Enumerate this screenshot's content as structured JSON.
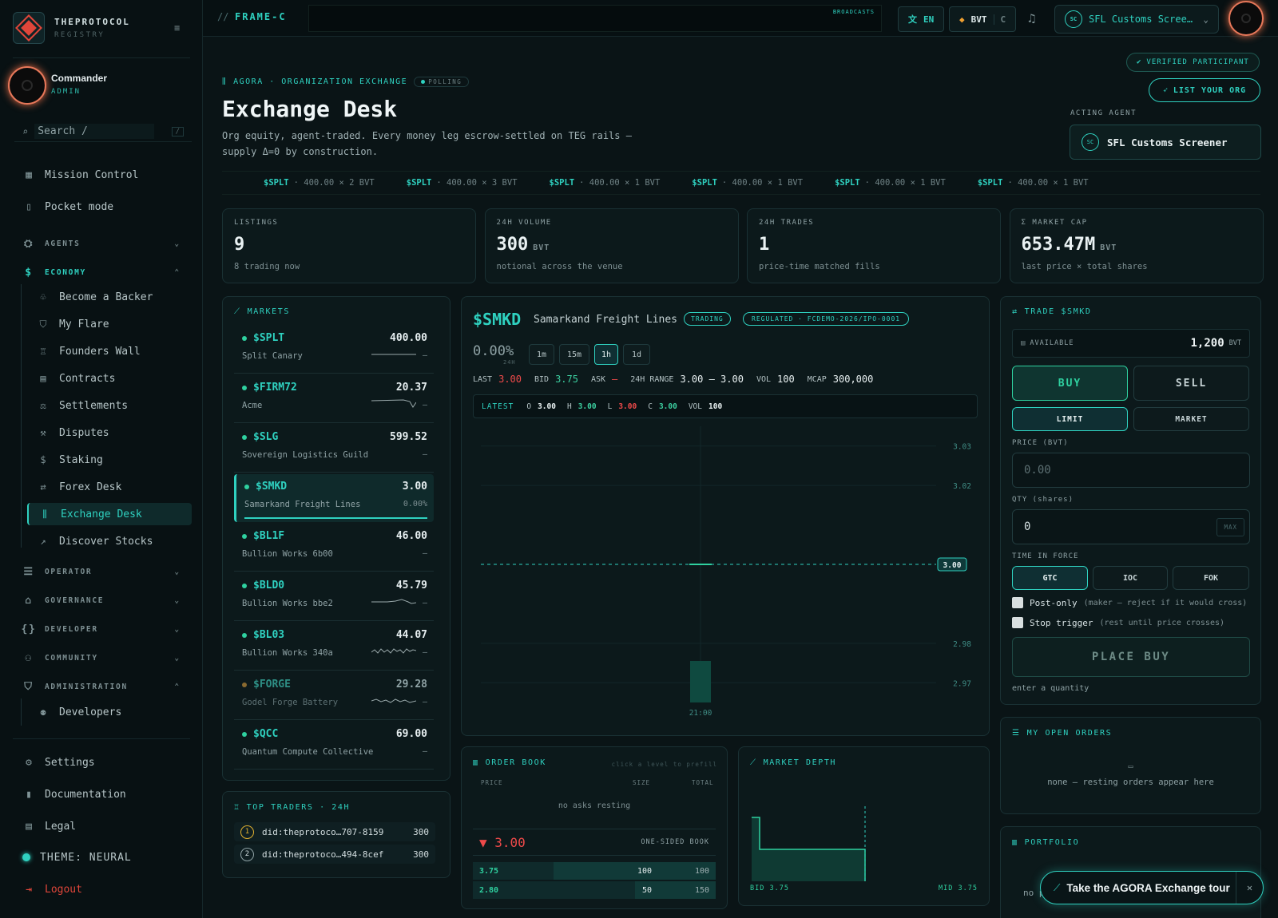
{
  "brand": {
    "name": "THEPROTOCOL",
    "sub": "REGISTRY"
  },
  "user": {
    "name": "Commander",
    "role": "ADMIN"
  },
  "search": {
    "placeholder": "Search  /",
    "shortcut": "/"
  },
  "nav": {
    "top": [
      "Mission Control",
      "Pocket mode"
    ],
    "sections": {
      "agents": "AGENTS",
      "economy": "ECONOMY",
      "operator": "OPERATOR",
      "governance": "GOVERNANCE",
      "developer": "DEVELOPER",
      "community": "COMMUNITY",
      "administration": "ADMINISTRATION"
    },
    "economy_items": [
      "Become a Backer",
      "My Flare",
      "Founders Wall",
      "Contracts",
      "Settlements",
      "Disputes",
      "Staking",
      "Forex Desk",
      "Exchange Desk",
      "Discover Stocks"
    ],
    "admin_items": [
      "Developers"
    ],
    "bottom": [
      "Settings",
      "Documentation",
      "Legal",
      "THEME: NEURAL",
      "Logout"
    ]
  },
  "topbar": {
    "frame": "FRAME-C",
    "frame_prefix": "//",
    "broadcasts": "BROADCASTS",
    "lang": "EN",
    "currency": "BVT",
    "currency_sub": "C",
    "agent": "SFL Customs Scree…",
    "agent_badge": "SC"
  },
  "header": {
    "verified": "VERIFIED PARTICIPANT",
    "list_org": "LIST YOUR ORG",
    "breadcrumb": "AGORA · ORGANIZATION EXCHANGE",
    "polling": "POLLING",
    "title": "Exchange Desk",
    "desc1": "Org equity, agent-traded. Every money leg escrow-settled on TEG rails —",
    "desc2": "supply Δ=0 by construction.",
    "acting_label": "ACTING AGENT",
    "acting_agent": "SFL Customs Screener",
    "acting_badge": "SC"
  },
  "ticker": [
    {
      "sym": "$SPLT",
      "text": "· 400.00 × 2 BVT"
    },
    {
      "sym": "$SPLT",
      "text": "· 400.00 × 3 BVT"
    },
    {
      "sym": "$SPLT",
      "text": "· 400.00 × 1 BVT"
    },
    {
      "sym": "$SPLT",
      "text": "· 400.00 × 1 BVT"
    },
    {
      "sym": "$SPLT",
      "text": "· 400.00 × 1 BVT"
    },
    {
      "sym": "$SPLT",
      "text": "· 400.00 × 1 BVT"
    }
  ],
  "stats": [
    {
      "label": "LISTINGS",
      "value": "9",
      "unit": "",
      "sub": "8 trading now"
    },
    {
      "label": "24H VOLUME",
      "value": "300",
      "unit": "BVT",
      "sub": "notional across the venue"
    },
    {
      "label": "24H TRADES",
      "value": "1",
      "unit": "",
      "sub": "price-time matched fills"
    },
    {
      "label": "Σ MARKET CAP",
      "value": "653.47M",
      "unit": "BVT",
      "sub": "last price × total shares"
    }
  ],
  "markets": {
    "title": "MARKETS",
    "rows": [
      {
        "sym": "$SPLT",
        "price": "400.00",
        "name": "Split Canary",
        "chg": "—"
      },
      {
        "sym": "$FIRM72",
        "price": "20.37",
        "name": "Acme",
        "chg": "—"
      },
      {
        "sym": "$SLG",
        "price": "599.52",
        "name": "Sovereign Logistics Guild",
        "chg": "—"
      },
      {
        "sym": "$SMKD",
        "price": "3.00",
        "name": "Samarkand Freight Lines",
        "chg": "0.00%"
      },
      {
        "sym": "$BL1F",
        "price": "46.00",
        "name": "Bullion Works 6b00",
        "chg": "—"
      },
      {
        "sym": "$BLD0",
        "price": "45.79",
        "name": "Bullion Works bbe2",
        "chg": "—"
      },
      {
        "sym": "$BL03",
        "price": "44.07",
        "name": "Bullion Works 340a",
        "chg": "—"
      },
      {
        "sym": "$FORGE",
        "price": "29.28",
        "name": "Godel Forge Battery",
        "chg": "—"
      },
      {
        "sym": "$QCC",
        "price": "69.00",
        "name": "Quantum Compute Collective",
        "chg": "—"
      }
    ]
  },
  "traders": {
    "title": "TOP TRADERS · 24H",
    "rows": [
      {
        "rank": "1",
        "id": "did:theprotoco…707-8159",
        "val": "300"
      },
      {
        "rank": "2",
        "id": "did:theprotoco…494-8cef",
        "val": "300"
      }
    ]
  },
  "chart": {
    "sym": "$SMKD",
    "name": "Samarkand Freight Lines",
    "status": "TRADING",
    "regulated": "REGULATED · FCDEMO-2026/IPO-0001",
    "change": "0.00%",
    "change_sub": "24H",
    "tfs": [
      "1m",
      "15m",
      "1h",
      "1d"
    ],
    "quote": {
      "last_l": "LAST",
      "last": "3.00",
      "bid_l": "BID",
      "bid": "3.75",
      "ask_l": "ASK",
      "ask": "—",
      "range_l": "24H RANGE",
      "range": "3.00 – 3.00",
      "vol_l": "VOL",
      "vol": "100",
      "mcap_l": "MCAP",
      "mcap": "300,000"
    },
    "latest": {
      "label": "LATEST",
      "o_l": "O",
      "o": "3.00",
      "h_l": "H",
      "h": "3.00",
      "l_l": "L",
      "l": "3.00",
      "c_l": "C",
      "c": "3.00",
      "v_l": "VOL",
      "v": "100"
    }
  },
  "chart_data": {
    "type": "line",
    "x": [
      "21:00"
    ],
    "series": [
      {
        "values": [
          3.0
        ]
      }
    ],
    "volume": [
      100
    ],
    "yticks": [
      "3.03",
      "3.02",
      "2.98",
      "2.97"
    ],
    "last_tag": "3.00",
    "ylim": [
      2.965,
      3.035
    ]
  },
  "orderbook": {
    "title": "ORDER BOOK",
    "hint": "click a level to prefill",
    "cols": [
      "PRICE",
      "SIZE",
      "TOTAL"
    ],
    "no_asks": "no asks resting",
    "mid": "▼ 3.00",
    "one_sided": "ONE-SIDED BOOK",
    "bids": [
      {
        "price": "3.75",
        "size": "100",
        "total": "100"
      },
      {
        "price": "2.80",
        "size": "50",
        "total": "150"
      }
    ]
  },
  "depth": {
    "title": "MARKET DEPTH",
    "bid": "BID 3.75",
    "mid": "MID 3.75"
  },
  "trade": {
    "title": "TRADE $SMKD",
    "avail_l": "AVAILABLE",
    "avail": "1,200",
    "avail_unit": "BVT",
    "buy": "BUY",
    "sell": "SELL",
    "limit": "LIMIT",
    "market": "MARKET",
    "price_l": "PRICE (BVT)",
    "price_ph": "0.00",
    "qty_l": "QTY (shares)",
    "qty": "0",
    "max": "MAX",
    "tif_l": "TIME IN FORCE",
    "tifs": [
      "GTC",
      "IOC",
      "FOK"
    ],
    "post_only": "Post-only",
    "post_note": "(maker — reject if it would cross)",
    "stop": "Stop trigger",
    "stop_note": "(rest until price crosses)",
    "place": "PLACE BUY",
    "hint": "enter a quantity"
  },
  "orders": {
    "title": "MY OPEN ORDERS",
    "empty": "none — resting orders appear here"
  },
  "portfolio": {
    "title": "PORTFOLIO",
    "partial": "no p"
  },
  "tour": {
    "label": "Take the AGORA Exchange tour"
  }
}
